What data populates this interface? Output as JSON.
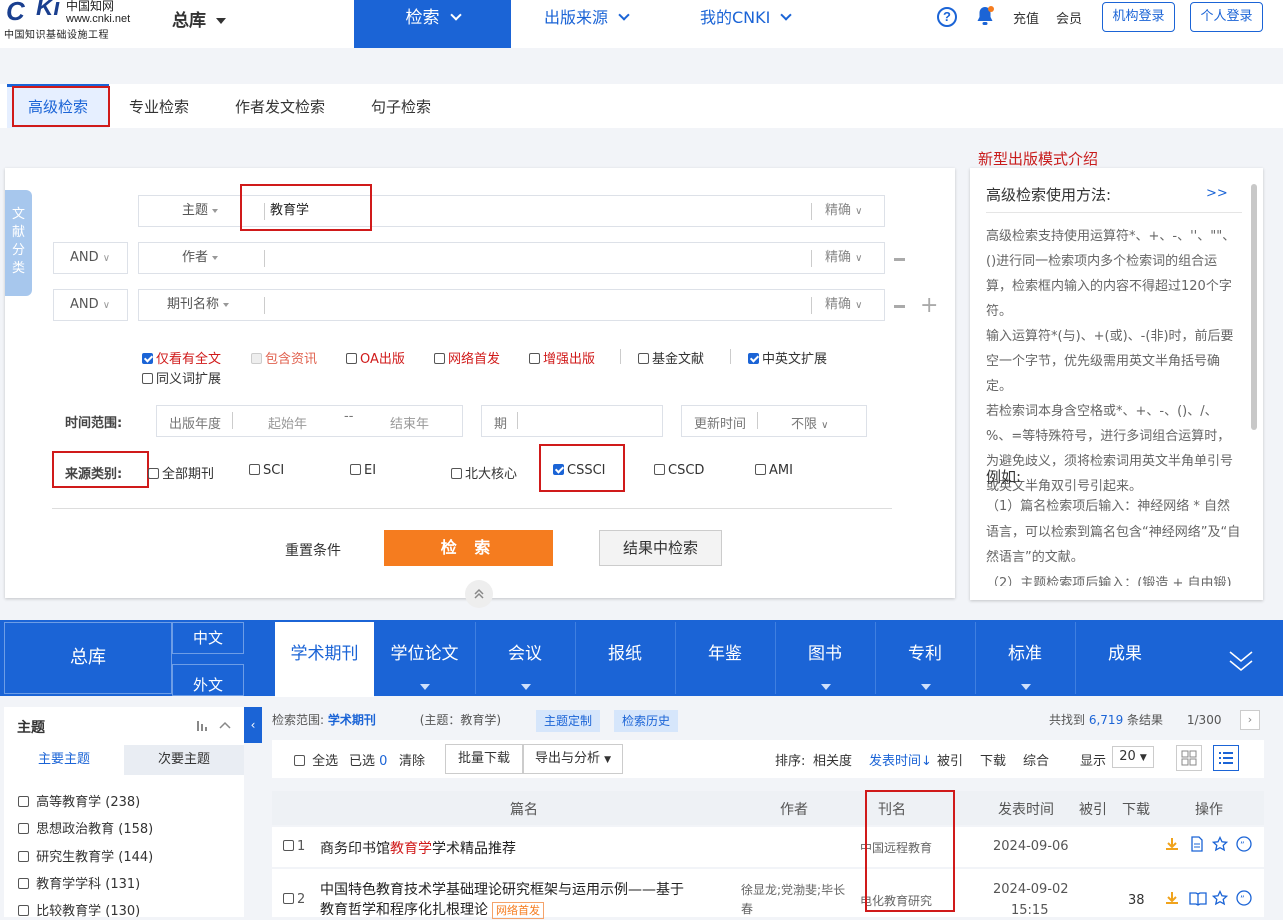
{
  "header": {
    "logo_cn": "中国知网",
    "logo_url": "www.cnki.net",
    "logo_sub": "中国知识基础设施工程",
    "library": "总库",
    "nav": [
      "检索",
      "出版来源",
      "我的CNKI"
    ],
    "links": [
      "充值",
      "会员"
    ],
    "btn_org": "机构登录",
    "btn_personal": "个人登录"
  },
  "tabs": [
    "高级检索",
    "专业检索",
    "作者发文检索",
    "句子检索"
  ],
  "new_model": "新型出版模式介绍",
  "side_label": "文献分类",
  "fields": [
    {
      "op": "",
      "name": "主题",
      "value": "教育学",
      "match": "精确"
    },
    {
      "op": "AND",
      "name": "作者",
      "value": "",
      "match": "精确"
    },
    {
      "op": "AND",
      "name": "期刊名称",
      "value": "",
      "match": "精确"
    }
  ],
  "options": [
    {
      "label": "仅看有全文",
      "checked": true,
      "red": true
    },
    {
      "label": "包含资讯",
      "checked": false,
      "red": true,
      "disabled": true
    },
    {
      "label": "OA出版",
      "checked": false,
      "red": true
    },
    {
      "label": "网络首发",
      "checked": false,
      "red": true
    },
    {
      "label": "增强出版",
      "checked": false,
      "red": true
    },
    {
      "label": "基金文献",
      "checked": false
    },
    {
      "label": "中英文扩展",
      "checked": true
    },
    {
      "label": "同义词扩展",
      "checked": false
    }
  ],
  "time": {
    "label": "时间范围:",
    "year_label": "出版年度",
    "start_ph": "起始年",
    "sep": "--",
    "end_ph": "结束年",
    "issue_label": "期",
    "update_label": "更新时间",
    "update_value": "不限"
  },
  "source": {
    "label": "来源类别:",
    "items": [
      {
        "label": "全部期刊",
        "checked": false
      },
      {
        "label": "SCI",
        "checked": false
      },
      {
        "label": "EI",
        "checked": false
      },
      {
        "label": "北大核心",
        "checked": false
      },
      {
        "label": "CSSCI",
        "checked": true
      },
      {
        "label": "CSCD",
        "checked": false
      },
      {
        "label": "AMI",
        "checked": false
      }
    ]
  },
  "actions": {
    "reset": "重置条件",
    "search": "检 索",
    "in_result": "结果中检索"
  },
  "help": {
    "title": "高级检索使用方法:",
    "more": ">>",
    "body": [
      "高级检索支持使用运算符*、+、-、''、\"\"、()进行同一检索项内多个检索词的组合运算，检索框内输入的内容不得超过120个字符。",
      "输入运算符*(与)、+(或)、-(非)时，前后要空一个字节，优先级需用英文半角括号确定。",
      "若检索词本身含空格或*、+、-、()、/、%、=等特殊符号，进行多词组合运算时，为避免歧义，须将检索词用英文半角单引号或英文半角双引号引起来。"
    ],
    "example_title": "例如:",
    "example_body": "（1）篇名检索项后输入：神经网络 * 自然语言，可以检索到篇名包含“神经网络”及“自然语言”的文献。",
    "example_body2": "（2）主题检索项后输入：(锻造 + 自由锻) *"
  },
  "db": {
    "all": "总库",
    "zh": "中文",
    "wai": "外文",
    "active": "学术期刊",
    "tabs": [
      "学位论文",
      "会议",
      "报纸",
      "年鉴",
      "图书",
      "专利",
      "标准",
      "成果"
    ]
  },
  "left": {
    "title": "主题",
    "tab_main": "主要主题",
    "tab_sec": "次要主题",
    "items": [
      "高等教育学 (238)",
      "思想政治教育 (158)",
      "研究生教育学 (144)",
      "教育学学科 (131)",
      "比较教育学 (130)"
    ]
  },
  "results": {
    "scope_label": "检索范围:",
    "scope_value": "学术期刊",
    "scope_query": "(主题：教育学)",
    "tag1": "主题定制",
    "tag2": "检索历史",
    "found_pre": "共找到",
    "found_count": "6,719",
    "found_post": "条结果",
    "page": "1/300",
    "select_all": "全选",
    "selected_label": "已选",
    "selected_count": "0",
    "clear": "清除",
    "batch": "批量下载",
    "export": "导出与分析",
    "sort_label": "排序:",
    "sort": [
      "相关度",
      "发表时间",
      "被引",
      "下载",
      "综合"
    ],
    "show_label": "显示",
    "show_value": "20",
    "headers": [
      "篇名",
      "作者",
      "刊名",
      "发表时间",
      "被引",
      "下载",
      "操作"
    ],
    "rows": [
      {
        "no": "1",
        "title_pre": "商务印书馆",
        "title_hl": "教育学",
        "title_post": "学术精品推荐",
        "author": "",
        "journal": "中国远程教育",
        "date": "2024-09-06",
        "time": "",
        "cited": "",
        "download": ""
      },
      {
        "no": "2",
        "title_pre": "中国特色教育技术学基础理论研究框架与运用示例——基于",
        "title_hl": "",
        "title_post": "",
        "title_line2": "教育哲学和程序化扎根理论",
        "badge": "网络首发",
        "author": "徐显龙;党渤斐;毕长春",
        "journal": "电化教育研究",
        "date": "2024-09-02",
        "time": "15:15",
        "cited": "",
        "download": "38"
      }
    ]
  }
}
